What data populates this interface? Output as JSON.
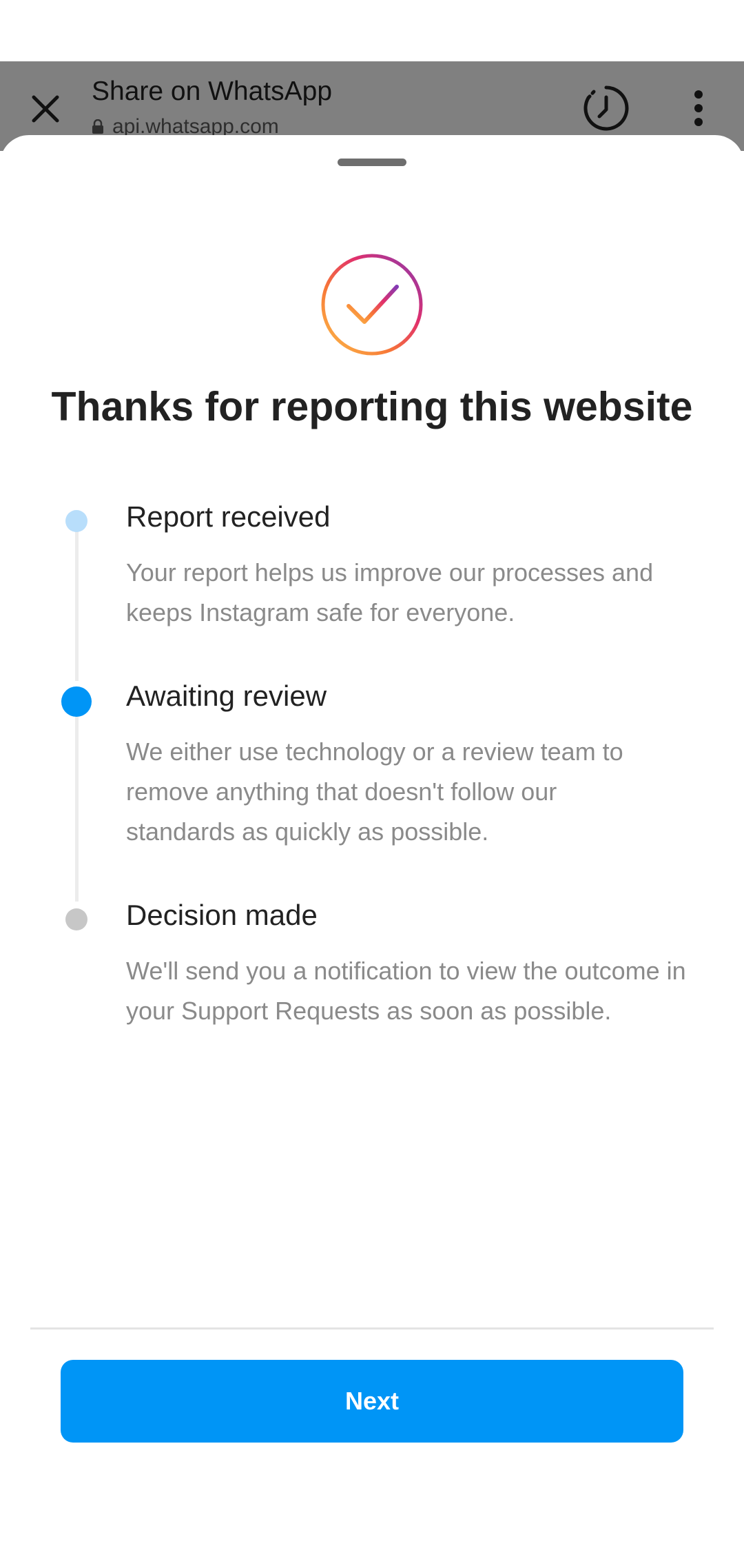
{
  "browser": {
    "title": "Share on WhatsApp",
    "url": "api.whatsapp.com",
    "background_color": "#808080",
    "icons": [
      "close-icon",
      "lock-icon",
      "history-icon",
      "more-vertical-icon"
    ]
  },
  "sheet": {
    "title": "Thanks for reporting this website",
    "success_icon": "gradient-checkmark-circle-icon",
    "steps": [
      {
        "title": "Report received",
        "description": "Your report helps us improve our processes and keeps Instagram safe for everyone.",
        "state": "completed",
        "dot_color": "#b8defb"
      },
      {
        "title": "Awaiting review",
        "description": "We either use technology or a review team to remove anything that doesn't follow our standards as quickly as possible.",
        "state": "current",
        "dot_color": "#0095f6"
      },
      {
        "title": "Decision made",
        "description": "We'll send you a notification to view the outcome in your Support Requests as soon as possible.",
        "state": "pending",
        "dot_color": "#c7c7c7"
      }
    ],
    "next_label": "Next",
    "accent_color": "#0095f6"
  }
}
